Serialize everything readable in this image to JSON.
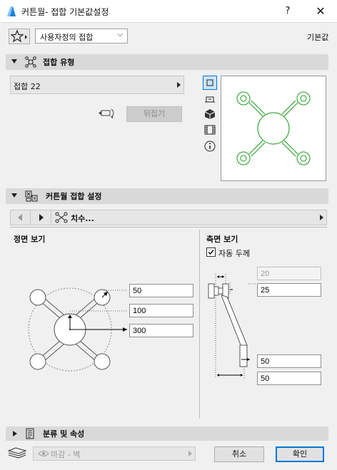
{
  "window": {
    "title": "커튼월- 접합 기본값설정",
    "help": "?",
    "close": "✕"
  },
  "top": {
    "favorites_dropdown": "사용자정의 접합",
    "default_label": "기본값"
  },
  "section_joint_type": {
    "title": "접합 유형",
    "selector_value": "접합 22",
    "flip_button": "뒤집기"
  },
  "section_settings": {
    "title": "커튼월 접합 설정",
    "page_title": "치수...",
    "front_view_title": "정면 보기",
    "side_view_title": "측면 보기",
    "auto_thickness_label": "자동 두께",
    "auto_thickness_checked": true,
    "front_values": [
      "50",
      "100",
      "300"
    ],
    "side_values": [
      "20",
      "25",
      "50",
      "50"
    ]
  },
  "section_classification": {
    "title": "분류 및 속성"
  },
  "bottom": {
    "layer_value": "마감 - 벽",
    "cancel": "취소",
    "ok": "확인"
  },
  "colors": {
    "preview_stroke": "#1a9a1a",
    "accent_border": "#0078d7"
  }
}
